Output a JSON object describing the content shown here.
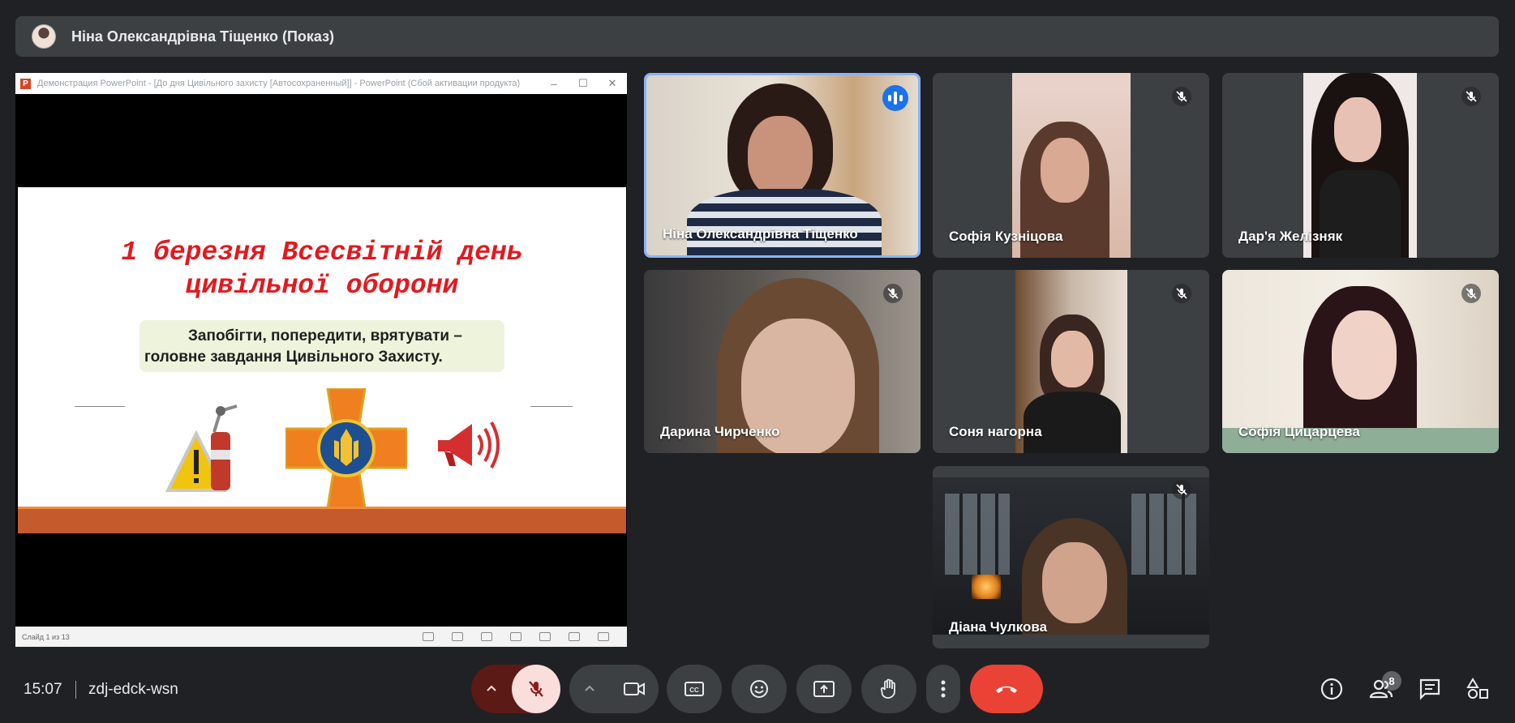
{
  "presenter_bar": {
    "name": "Ніна Олександрівна Тіщенко (Показ)"
  },
  "presentation": {
    "window_title": "Демонстрация PowerPoint - [До дня Цивільного захисту [Автосохраненный]] - PowerPoint (Сбой активации продукта)",
    "slide_title_line1": "1 березня Всесвітній день",
    "slide_title_line2": "цивільної оборони",
    "subtitle_line1": "Запобігти, попередити, врятувати –",
    "subtitle_line2": "головне завдання Цивільного Захисту.",
    "status_text": "Слайд 1 из 13",
    "title_color": "#e2191f"
  },
  "participants": [
    {
      "name": "Ніна Олександрівна Тіщенко",
      "speaking": true,
      "mic": "active"
    },
    {
      "name": "Софія Кузніцова",
      "mic": "muted"
    },
    {
      "name": "Дар'я Желізняк",
      "mic": "muted"
    },
    {
      "name": "Дарина Чирченко",
      "mic": "muted"
    },
    {
      "name": "Соня нагорна",
      "mic": "muted"
    },
    {
      "name": "Софія Цицарцева",
      "mic": "muted"
    },
    {
      "name": "Діана Чулкова",
      "mic": "muted"
    }
  ],
  "bottom_bar": {
    "time": "15:07",
    "meeting_code": "zdj-edck-wsn",
    "people_count": "8",
    "controls": [
      "chevron-up-icon",
      "mic-off-icon",
      "chevron-up-icon",
      "camera-icon",
      "captions-icon",
      "emoji-icon",
      "present-icon",
      "raise-hand-icon",
      "more-vert-icon",
      "end-call-icon"
    ],
    "right_controls": [
      "info-icon",
      "people-icon",
      "chat-icon",
      "activities-icon"
    ],
    "colors": {
      "end_call": "#ea4335",
      "mic_off_bg": "#f9dedc",
      "mic_off_fg": "#8c1d18",
      "accent": "#8ab4f8"
    }
  }
}
